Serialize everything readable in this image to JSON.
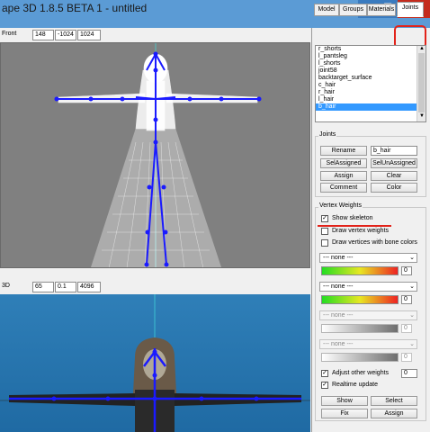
{
  "window": {
    "title": "ape 3D 1.8.5 BETA 1 - untitled",
    "minimize_glyph": "—",
    "maximize_glyph": "❐",
    "close_glyph": "✕",
    "bar_color": "#5b9bd5"
  },
  "front_view": {
    "mode": "Front",
    "fields": [
      "148",
      "-1024",
      "1024"
    ],
    "background": "#808080"
  },
  "persp_view": {
    "mode": "3D",
    "fields": [
      "65",
      "0.1",
      "4096"
    ],
    "background": "#2f7fb8"
  },
  "tabs": [
    {
      "label": "Model"
    },
    {
      "label": "Groups"
    },
    {
      "label": "Materials"
    },
    {
      "label": "Joints"
    }
  ],
  "active_tab": "Joints",
  "highlight_color": "#e2231a",
  "joint_list": {
    "items": [
      "r_shorts",
      "l_pantsleg",
      "l_shorts",
      "joint58",
      "backtarget_surface",
      "c_hair",
      "r_hair",
      "l_hair",
      "b_hair"
    ],
    "selected": "b_hair"
  },
  "joints_panel": {
    "group_label": "Joints",
    "rename_label": "Rename",
    "name_value": "b_hair",
    "sel_assigned_label": "SelAssigned",
    "sel_unassigned_label": "SelUnAssigned",
    "assign_label": "Assign",
    "clear_label": "Clear",
    "comment_label": "Comment",
    "color_label": "Color"
  },
  "vertex_weights": {
    "group_label": "Vertex Weights",
    "show_skeleton": {
      "label": "Show skeleton",
      "checked": true
    },
    "draw_vertex_weights": {
      "label": "Draw vertex weights",
      "checked": false
    },
    "draw_bone_colors": {
      "label": "Draw vertices with bone colors",
      "checked": false
    },
    "rows": [
      {
        "combo": "--- none ---",
        "value": "0",
        "enabled": true
      },
      {
        "combo": "--- none ---",
        "value": "0",
        "enabled": true
      },
      {
        "combo": "--- none ---",
        "value": "0",
        "enabled": false
      },
      {
        "combo": "--- none ---",
        "value": "0",
        "enabled": false
      }
    ],
    "adjust_other": {
      "label": "Adjust other weights",
      "checked": true,
      "value": "0"
    },
    "realtime_update": {
      "label": "Realtime update",
      "checked": true
    },
    "show_label": "Show",
    "select_label": "Select",
    "fix_label": "Fix",
    "assign_label": "Assign"
  },
  "skeleton_color": "#1a1aff"
}
